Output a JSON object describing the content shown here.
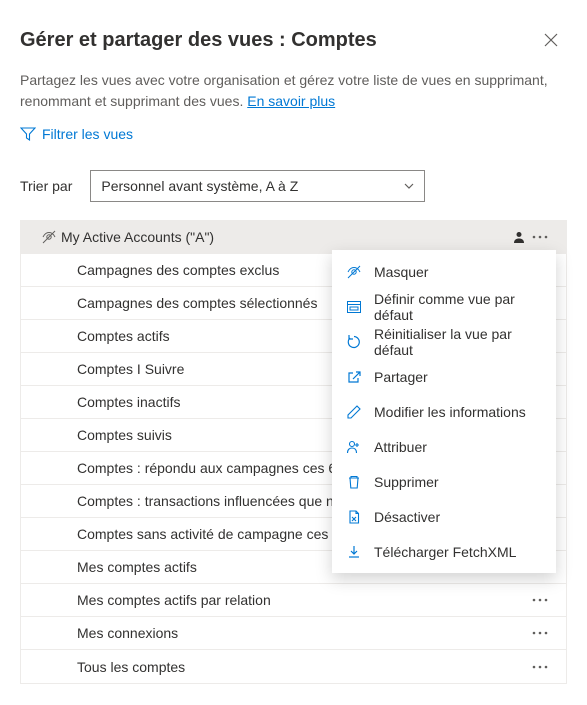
{
  "header": {
    "title": "Gérer et partager des vues : Comptes"
  },
  "description_prefix": "Partagez les vues avec votre organisation et gérez votre liste de vues en supprimant, renommant et supprimant des vues. ",
  "learn_more": "En savoir plus",
  "filter_label": "Filtrer les vues",
  "sort_label": "Trier par",
  "sort_value": "Personnel avant système, A à Z",
  "views": [
    {
      "label": "My Active Accounts (\"A\")",
      "selected": true,
      "personal": true,
      "show_more": true
    },
    {
      "label": "Campagnes des comptes exclus"
    },
    {
      "label": "Campagnes des comptes sélectionnés"
    },
    {
      "label": "Comptes actifs"
    },
    {
      "label": "Comptes I Suivre"
    },
    {
      "label": "Comptes inactifs"
    },
    {
      "label": "Comptes suivis"
    },
    {
      "label": "Comptes : répondu aux campagnes ces 6 derniers mois"
    },
    {
      "label": "Comptes : transactions influencées que nous avons gagnées"
    },
    {
      "label": "Comptes sans activité de campagne ces 3 derniers mois"
    },
    {
      "label": "Mes comptes actifs"
    },
    {
      "label": "Mes comptes actifs par relation",
      "show_more": true
    },
    {
      "label": "Mes connexions",
      "show_more": true
    },
    {
      "label": "Tous les comptes",
      "show_more": true
    }
  ],
  "menu": [
    {
      "icon": "hide",
      "label": "Masquer"
    },
    {
      "icon": "default",
      "label": "Définir comme vue par défaut"
    },
    {
      "icon": "reset",
      "label": "Réinitialiser la vue par défaut"
    },
    {
      "icon": "share",
      "label": "Partager"
    },
    {
      "icon": "edit",
      "label": "Modifier les informations"
    },
    {
      "icon": "assign",
      "label": "Attribuer"
    },
    {
      "icon": "delete",
      "label": "Supprimer"
    },
    {
      "icon": "deactivate",
      "label": "Désactiver"
    },
    {
      "icon": "download",
      "label": "Télécharger FetchXML"
    }
  ]
}
